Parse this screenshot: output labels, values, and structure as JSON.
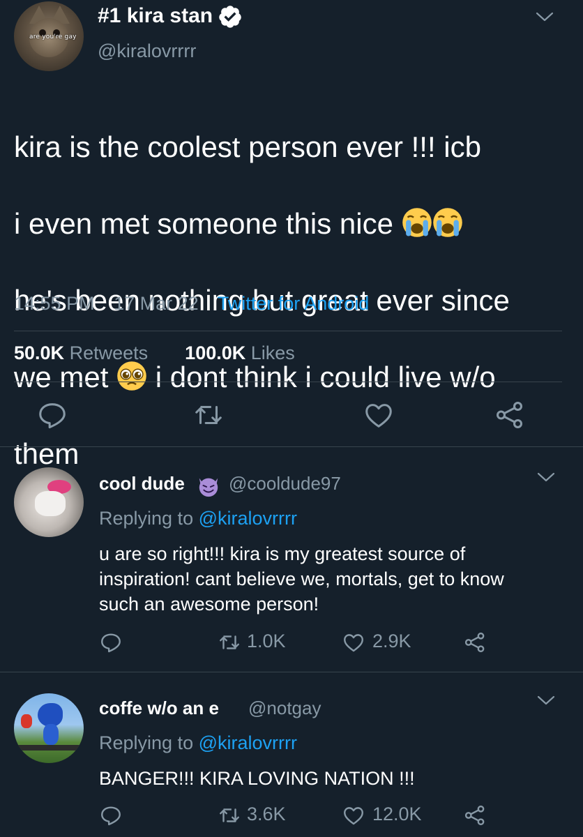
{
  "main_tweet": {
    "display_name": "#1 kira stan",
    "handle": "@kiralovrrrr",
    "avatar_caption": "are you're gay",
    "text_lines": [
      "kira is the coolest person ever !!! icb",
      "i even met someone this nice",
      "he's been nothing but great ever since",
      "we met",
      "i dont think i could live w/o",
      "them"
    ],
    "emojis": [
      "loudly-crying-face",
      "loudly-crying-face",
      "pleading-face"
    ],
    "time": "14:55 PM",
    "date": "17 Mar 22",
    "source": "Twitter for Android",
    "retweets_count": "50.0K",
    "retweets_label": "Retweets",
    "likes_count": "100.0K",
    "likes_label": "Likes"
  },
  "replies": [
    {
      "display_name": "cool dude",
      "name_emoji": "smiling-face-with-horns",
      "handle": "@cooldude97",
      "replying_prefix": "Replying to",
      "replying_to": "@kiralovrrrr",
      "text": "u are so right!!! kira is my greatest source of\ninspiration! cant believe we, mortals, get to know\nsuch an awesome person!",
      "retweets": "1.0K",
      "likes": "2.9K"
    },
    {
      "display_name": "coffe w/o an e",
      "handle": "@notgay",
      "replying_prefix": "Replying to",
      "replying_to": "@kiralovrrrr",
      "text": "BANGER!!! KIRA LOVING NATION !!!",
      "retweets": "3.6K",
      "likes": "12.0K"
    }
  ],
  "colors": {
    "background": "#15202b",
    "muted": "#8899a6",
    "link": "#1da1f2",
    "verified": "#ffffff",
    "divider": "#38444d"
  }
}
